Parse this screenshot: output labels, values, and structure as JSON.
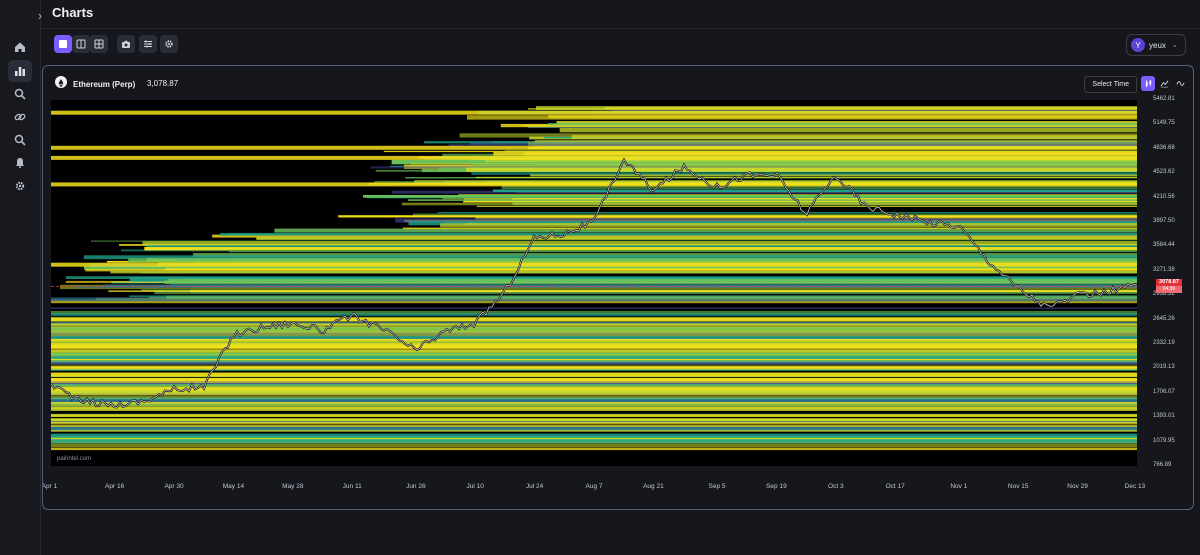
{
  "page": {
    "title": "Charts"
  },
  "sidebar": {
    "items": [
      {
        "icon": "home-icon",
        "active": false
      },
      {
        "icon": "bar-chart-icon",
        "active": true
      },
      {
        "icon": "zoom-search-icon",
        "active": false
      },
      {
        "icon": "link-icon",
        "active": false
      },
      {
        "icon": "search-icon",
        "active": false
      },
      {
        "icon": "bell-icon",
        "active": false
      },
      {
        "icon": "gear-icon",
        "active": false
      }
    ]
  },
  "toolbar": {
    "layout_buttons": [
      "layout-single-icon",
      "layout-split-icon",
      "layout-grid-icon"
    ],
    "tool_buttons": [
      "camera-icon",
      "sliders-icon",
      "gear-icon"
    ]
  },
  "user": {
    "initial": "Y",
    "name": "yeux"
  },
  "chart_panel": {
    "symbol": "Ethereum (Perp)",
    "price": "3,078.87",
    "select_time_label": "Select Time",
    "watermark": "pairintel.com",
    "current_price_tag": "3078.87",
    "current_price_sub": "04:36"
  },
  "colors": {
    "accent": "#7c5cff",
    "price_tag": "#e0323d",
    "heat_low": "#3b3f8f",
    "heat_mid": "#1ea08a",
    "heat_high": "#f4e11b"
  },
  "chart_data": {
    "type": "heatmap",
    "title": "",
    "x_ticks": [
      "Apr 1",
      "Apr 16",
      "Apr 30",
      "May 14",
      "May 28",
      "Jun 11",
      "Jun 26",
      "Jul 10",
      "Jul 24",
      "Aug 7",
      "Aug 21",
      "Sep 5",
      "Sep 19",
      "Oct 3",
      "Oct 17",
      "Nov 1",
      "Nov 15",
      "Nov 29",
      "Dec 13"
    ],
    "y_ticks": [
      "5462.81",
      "5149.75",
      "4836.68",
      "4523.62",
      "4210.56",
      "3897.50",
      "3584.44",
      "3271.38",
      "2958.32",
      "2645.26",
      "2332.19",
      "2019.13",
      "1706.07",
      "1393.01",
      "1079.95",
      "766.89"
    ],
    "ylim": [
      766.89,
      5462.81
    ],
    "current_price": 3078.87,
    "price_path": [
      {
        "x": "Apr 1",
        "y": 1820
      },
      {
        "x": "Apr 8",
        "y": 1600
      },
      {
        "x": "Apr 16",
        "y": 1550
      },
      {
        "x": "Apr 23",
        "y": 1600
      },
      {
        "x": "Apr 30",
        "y": 1750
      },
      {
        "x": "May 7",
        "y": 1780
      },
      {
        "x": "May 14",
        "y": 2450
      },
      {
        "x": "May 21",
        "y": 2550
      },
      {
        "x": "May 28",
        "y": 2600
      },
      {
        "x": "Jun 4",
        "y": 2500
      },
      {
        "x": "Jun 11",
        "y": 2700
      },
      {
        "x": "Jun 19",
        "y": 2500
      },
      {
        "x": "Jun 26",
        "y": 2250
      },
      {
        "x": "Jul 3",
        "y": 2500
      },
      {
        "x": "Jul 10",
        "y": 2600
      },
      {
        "x": "Jul 17",
        "y": 3000
      },
      {
        "x": "Jul 24",
        "y": 3700
      },
      {
        "x": "Jul 31",
        "y": 3750
      },
      {
        "x": "Aug 7",
        "y": 3900
      },
      {
        "x": "Aug 14",
        "y": 4700
      },
      {
        "x": "Aug 21",
        "y": 4300
      },
      {
        "x": "Aug 28",
        "y": 4600
      },
      {
        "x": "Sep 5",
        "y": 4350
      },
      {
        "x": "Sep 12",
        "y": 4500
      },
      {
        "x": "Sep 19",
        "y": 4500
      },
      {
        "x": "Sep 26",
        "y": 4000
      },
      {
        "x": "Oct 3",
        "y": 4500
      },
      {
        "x": "Oct 10",
        "y": 4100
      },
      {
        "x": "Oct 17",
        "y": 4000
      },
      {
        "x": "Oct 24",
        "y": 3900
      },
      {
        "x": "Nov 1",
        "y": 3850
      },
      {
        "x": "Nov 8",
        "y": 3400
      },
      {
        "x": "Nov 15",
        "y": 3050
      },
      {
        "x": "Nov 22",
        "y": 2800
      },
      {
        "x": "Nov 29",
        "y": 2950
      },
      {
        "x": "Dec 6",
        "y": 3000
      },
      {
        "x": "Dec 13",
        "y": 3100
      }
    ]
  }
}
